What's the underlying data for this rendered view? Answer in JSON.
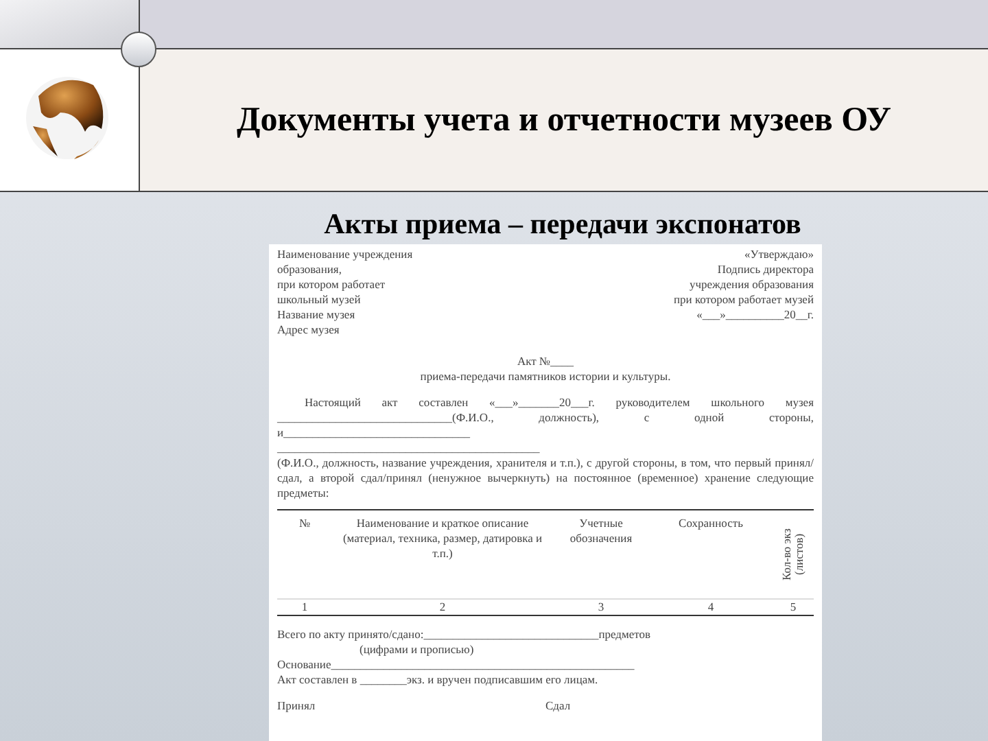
{
  "slide": {
    "title": "Документы учета и отчетности музеев ОУ",
    "subtitle": "Акты приема – передачи экспонатов"
  },
  "document": {
    "header_left": [
      "Наименование учреждения",
      "образования,",
      "при котором работает",
      "школьный музей",
      "Название музея",
      "Адрес музея"
    ],
    "header_right": [
      "«Утверждаю»",
      "Подпись директора",
      "учреждения образования",
      "при котором работает музей",
      "«___»__________20__г."
    ],
    "act_number": "Акт №____",
    "act_subject": "приема-передачи памятников истории и культуры.",
    "body": [
      "Настоящий акт составлен «___»_______20___г. руководителем школьного музея ______________________________(Ф.И.О., должность), с одной стороны, и________________________________",
      "_____________________________________________",
      "(Ф.И.О., должность, название учреждения, хранителя и т.п.), с другой стороны, в том, что первый принял/сдал, а второй сдал/принял (ненужное вычеркнуть) на постоянное (временное) хранение следующие предметы:"
    ],
    "table": {
      "columns": [
        "№",
        "Наименование и краткое описание (материал, техника, размер, датировка и т.п.)",
        "Учетные обозначения",
        "Сохранность",
        "Кол-во экз (листов)"
      ],
      "numbers": [
        "1",
        "2",
        "3",
        "4",
        "5"
      ]
    },
    "footer": {
      "total": "Всего по акту принято/сдано:______________________________предметов",
      "total_hint": "(цифрами и прописью)",
      "basis": "Основание____________________________________________________",
      "copies": "Акт составлен в ________экз. и вручен подписавшим его лицам.",
      "signatures": [
        "Принял",
        "Сдал"
      ]
    }
  }
}
